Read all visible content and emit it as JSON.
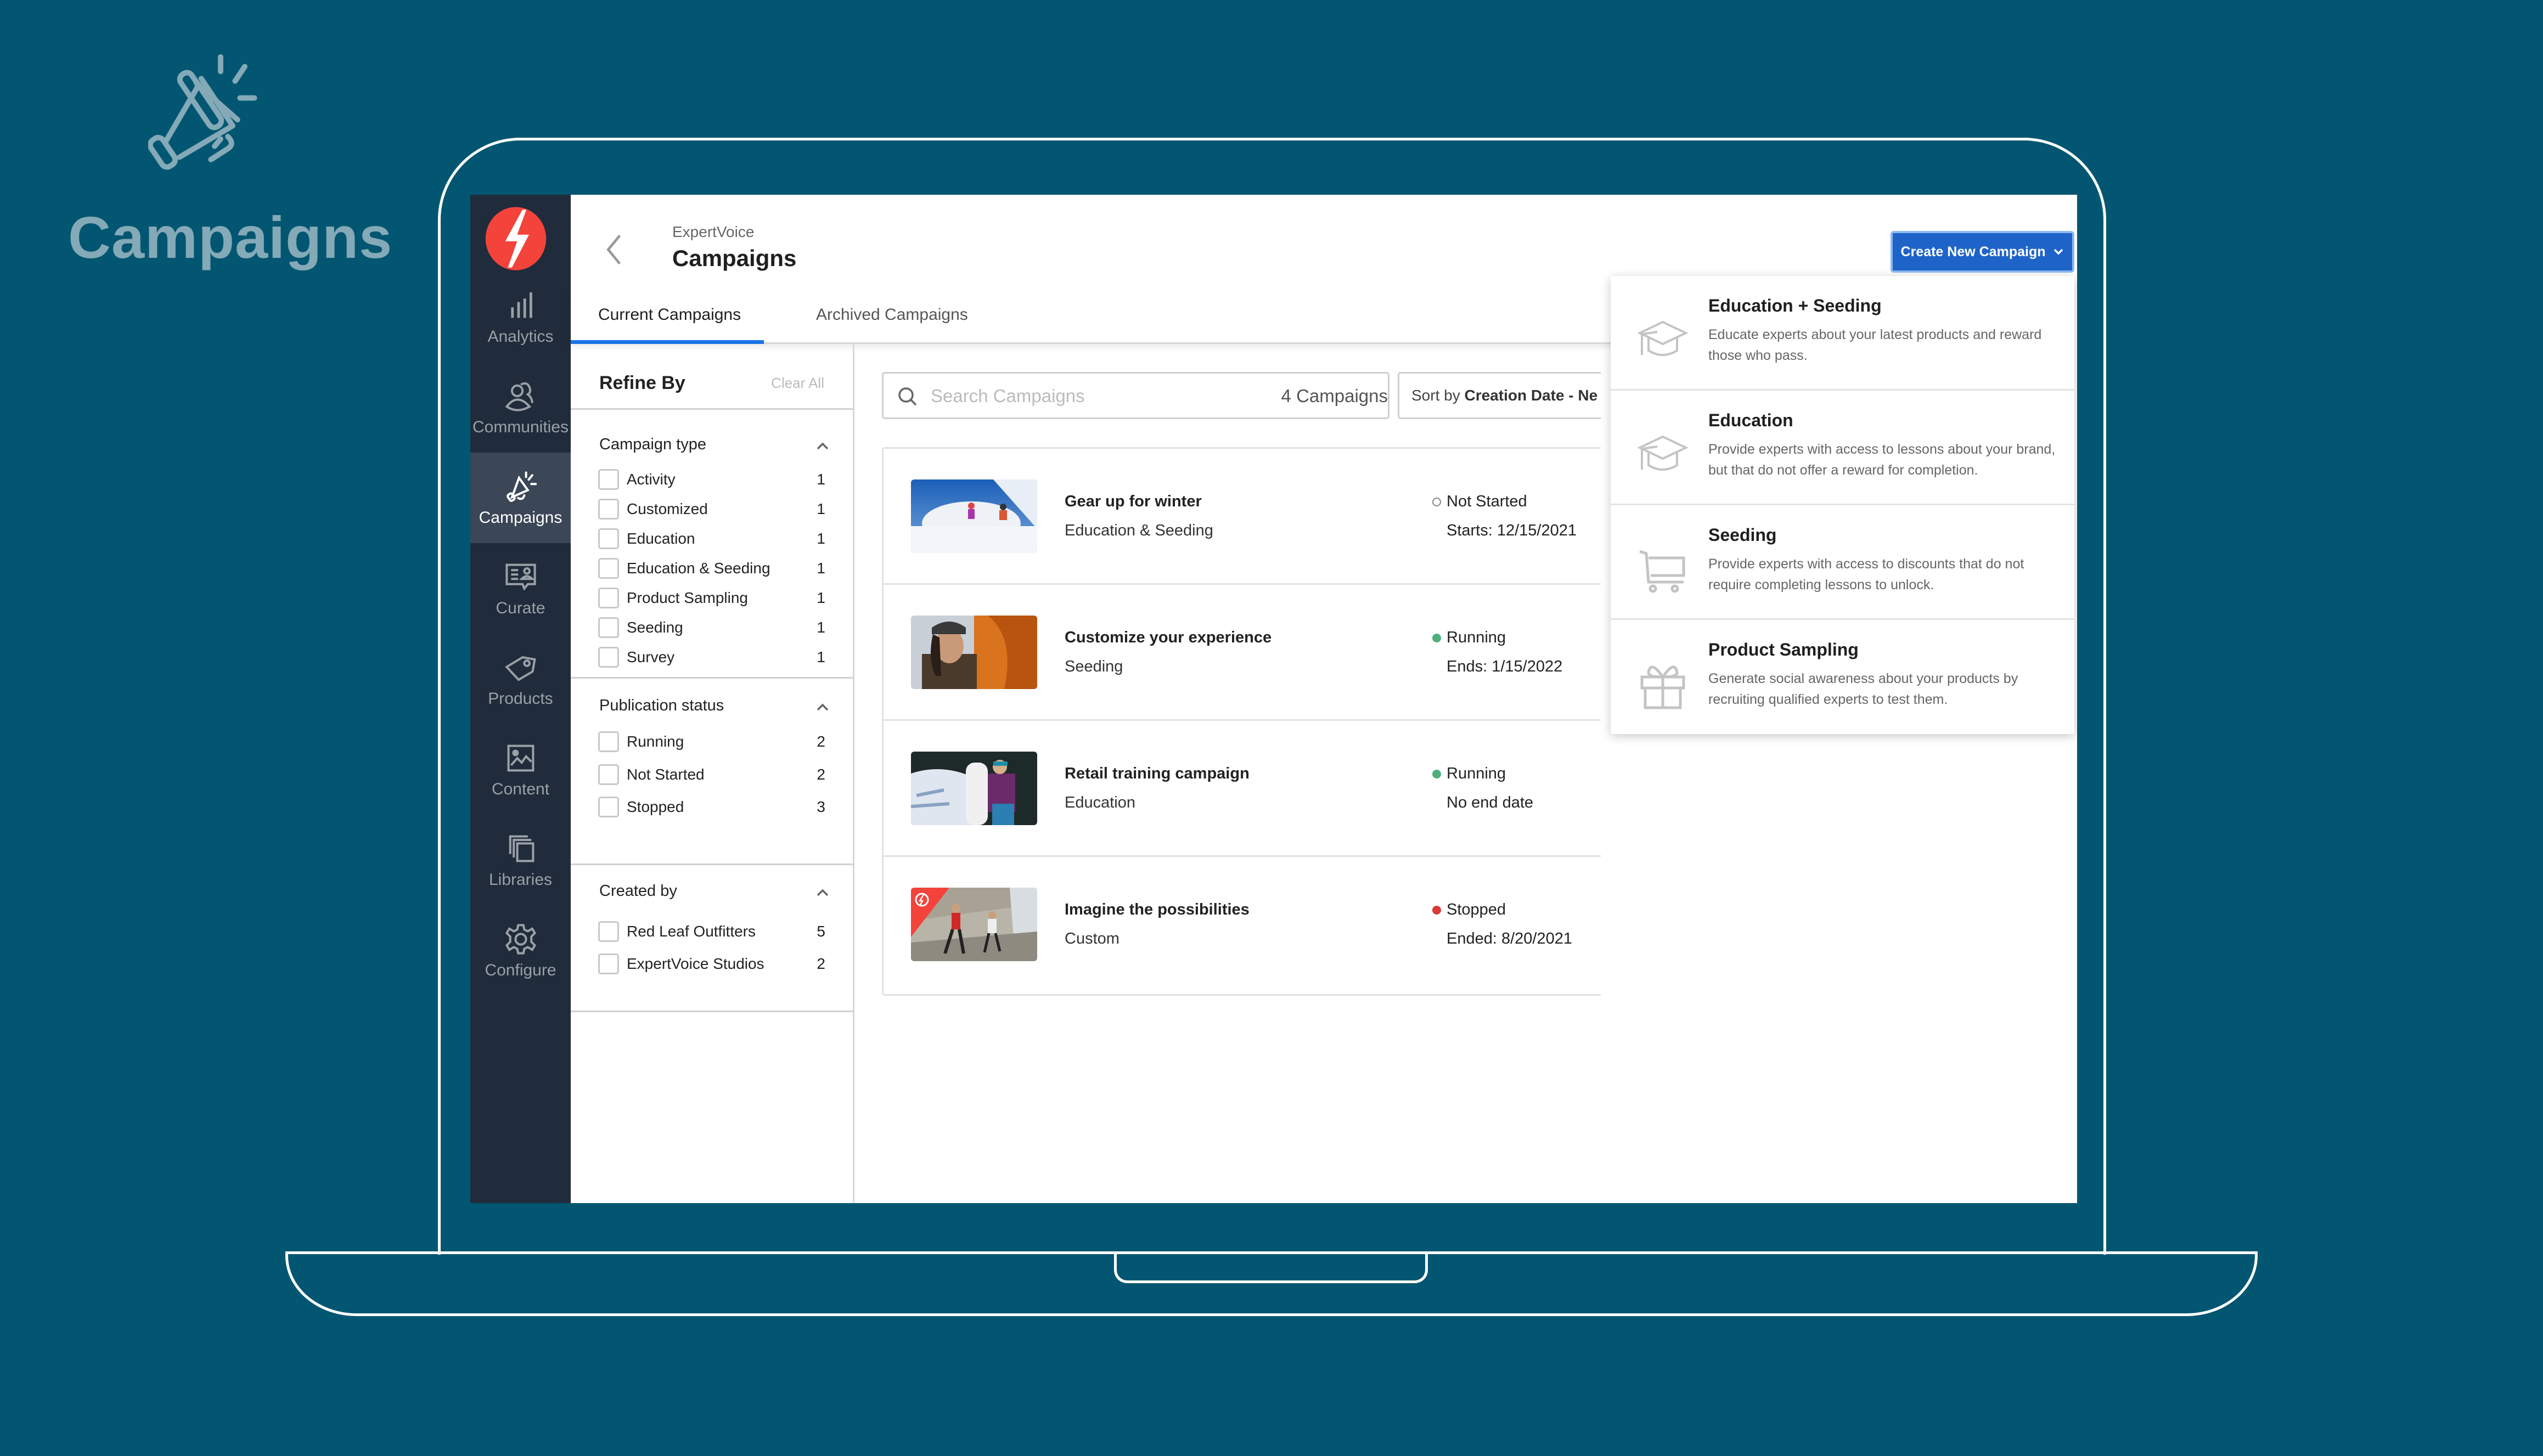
{
  "hero": {
    "title": "Campaigns",
    "icon": "megaphone-icon"
  },
  "app": {
    "breadcrumb": "ExpertVoice",
    "title": "Campaigns",
    "tabs": [
      {
        "label": "Current Campaigns",
        "active": true
      },
      {
        "label": "Archived Campaigns",
        "active": false
      }
    ],
    "create_button": {
      "label": "Create New Campaign",
      "icon": "chevron-down-icon"
    }
  },
  "sidebar": {
    "logo": "expertvoice-bolt-logo",
    "items": [
      {
        "label": "Analytics",
        "icon": "bar-chart-icon",
        "active": false
      },
      {
        "label": "Communities",
        "icon": "users-icon",
        "active": false
      },
      {
        "label": "Campaigns",
        "icon": "megaphone-icon",
        "active": true
      },
      {
        "label": "Curate",
        "icon": "curate-icon",
        "active": false
      },
      {
        "label": "Products",
        "icon": "tag-icon",
        "active": false
      },
      {
        "label": "Content",
        "icon": "image-icon",
        "active": false
      },
      {
        "label": "Libraries",
        "icon": "stack-icon",
        "active": false
      },
      {
        "label": "Configure",
        "icon": "gear-icon",
        "active": false
      }
    ]
  },
  "filters": {
    "title": "Refine By",
    "clear_all": "Clear All",
    "groups": [
      {
        "title": "Campaign type",
        "options": [
          {
            "label": "Activity",
            "count": "1"
          },
          {
            "label": "Customized",
            "count": "1"
          },
          {
            "label": "Education",
            "count": "1"
          },
          {
            "label": "Education & Seeding",
            "count": "1"
          },
          {
            "label": "Product Sampling",
            "count": "1"
          },
          {
            "label": "Seeding",
            "count": "1"
          },
          {
            "label": "Survey",
            "count": "1"
          }
        ]
      },
      {
        "title": "Publication status",
        "options": [
          {
            "label": "Running",
            "count": "2"
          },
          {
            "label": "Not Started",
            "count": "2"
          },
          {
            "label": "Stopped",
            "count": "3"
          }
        ]
      },
      {
        "title": "Created by",
        "options": [
          {
            "label": "Red Leaf Outfitters",
            "count": "5"
          },
          {
            "label": "ExpertVoice Studios",
            "count": "2"
          }
        ]
      }
    ]
  },
  "search": {
    "placeholder": "Search Campaigns",
    "value": "",
    "count": "4 Campaigns"
  },
  "sort": {
    "prefix": "Sort by",
    "value": "Creation Date - Ne"
  },
  "campaigns": [
    {
      "title": "Gear up for winter",
      "type": "Education & Seeding",
      "status": "Not Started",
      "status_color": "hollow",
      "date": "Starts: 12/15/2021"
    },
    {
      "title": "Customize your experience",
      "type": "Seeding",
      "status": "Running",
      "status_color": "#4caf7d",
      "date": "Ends: 1/15/2022"
    },
    {
      "title": "Retail training campaign",
      "type": "Education",
      "status": "Running",
      "status_color": "#4caf7d",
      "date": "No end date"
    },
    {
      "title": "Imagine the possibilities",
      "type": "Custom",
      "status": "Stopped",
      "status_color": "#d93a33",
      "date": "Ended: 8/20/2021"
    }
  ],
  "create_menu": [
    {
      "title": "Education + Seeding",
      "desc": "Educate experts about your latest products and reward those who pass.",
      "icon": "graduation-cap-icon"
    },
    {
      "title": "Education",
      "desc": "Provide experts with access to lessons about your brand, but that do not offer a reward for completion.",
      "icon": "graduation-cap-icon"
    },
    {
      "title": "Seeding",
      "desc": "Provide experts with access to discounts that do not require completing lessons to unlock.",
      "icon": "shopping-cart-icon"
    },
    {
      "title": "Product Sampling",
      "desc": "Generate social awareness about your products by recruiting qualified experts to test them.",
      "icon": "gift-icon"
    }
  ],
  "colors": {
    "background": "#025671",
    "sidebar": "#202b3b",
    "sidebar_active": "#3b4757",
    "brand_red": "#f4433a",
    "primary_blue": "#1e64c8",
    "tab_underline": "#1a73e8",
    "running": "#4caf7d",
    "stopped": "#d93a33"
  }
}
